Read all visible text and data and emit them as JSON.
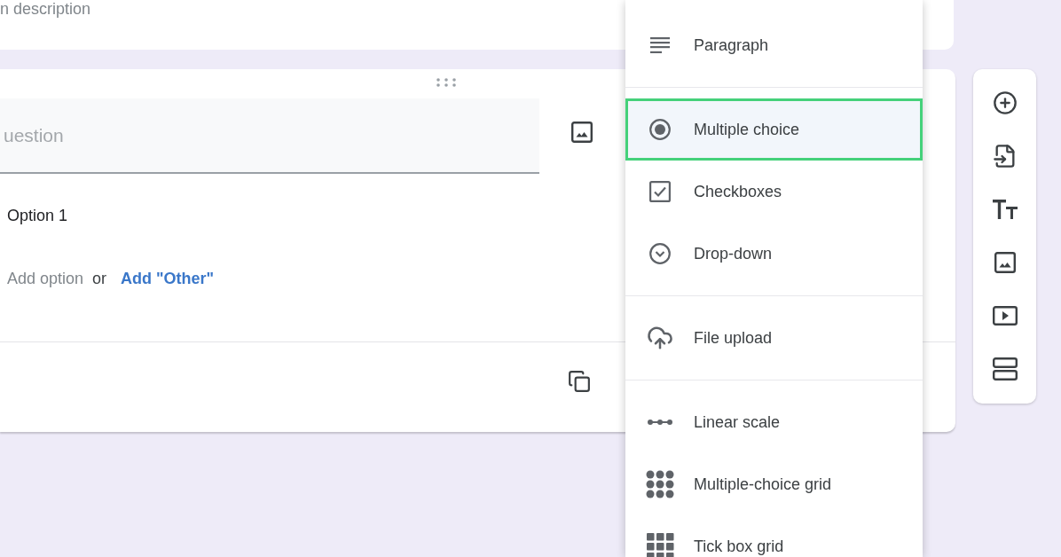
{
  "description_card": {
    "description": {
      "placeholder": "n description"
    }
  },
  "question_card": {
    "question": {
      "placeholder": "uestion"
    },
    "options": [
      {
        "label": "Option 1"
      }
    ],
    "add_option": "Add option",
    "separator": "or",
    "add_other": "Add \"Other\""
  },
  "question_type_menu": {
    "sections": [
      {
        "items": [
          {
            "kind": "paragraph",
            "label": "Paragraph",
            "selected": false
          }
        ]
      },
      {
        "items": [
          {
            "kind": "multiple-choice",
            "label": "Multiple choice",
            "selected": true
          },
          {
            "kind": "checkboxes",
            "label": "Checkboxes",
            "selected": false
          },
          {
            "kind": "dropdown",
            "label": "Drop-down",
            "selected": false
          }
        ]
      },
      {
        "items": [
          {
            "kind": "file-upload",
            "label": "File upload",
            "selected": false
          }
        ]
      },
      {
        "items": [
          {
            "kind": "linear-scale",
            "label": "Linear scale",
            "selected": false
          },
          {
            "kind": "choice-grid",
            "label": "Multiple-choice grid",
            "selected": false
          },
          {
            "kind": "tick-grid",
            "label": "Tick box grid",
            "selected": false
          }
        ]
      }
    ]
  }
}
